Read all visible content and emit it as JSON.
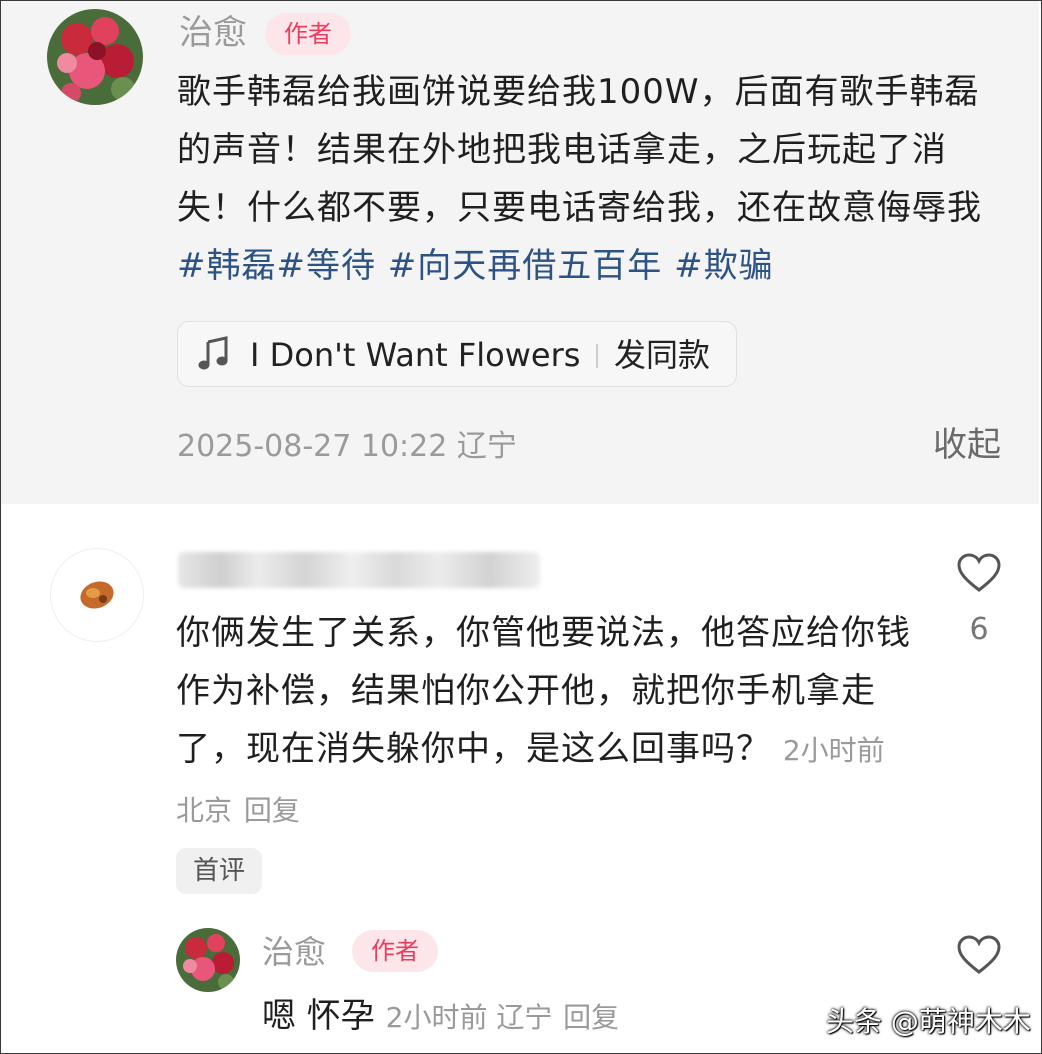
{
  "post": {
    "author": "治愈",
    "badge": "作者",
    "text_plain": "歌手韩磊给我画饼说要给我100W，后面有歌手韩磊的声音！结果在外地把我电话拿走，之后玩起了消失！什么都不要，只要电话寄给我，还在故意侮辱我",
    "tags": [
      "#韩磊",
      "#等待",
      " #向天再借五百年",
      " #欺骗"
    ],
    "music": {
      "icon": "music-note-icon",
      "title": "I Don't Want Flowers",
      "action": "发同款"
    },
    "time_location": "2025-08-27 10:22 辽宁",
    "collapse": "收起"
  },
  "comment": {
    "author_blurred": true,
    "text": "你俩发生了关系，你管他要说法，他答应给你钱作为补偿，结果怕你公开他，就把你手机拿走了，现在消失躲你中，是这么回事吗？",
    "meta": "2小时前 北京",
    "reply": "回复",
    "likes": "6",
    "first_tag": "首评"
  },
  "reply": {
    "author": "治愈",
    "badge": "作者",
    "text": "嗯 怀孕",
    "meta": "2小时前 辽宁",
    "reply": "回复"
  },
  "watermark": "头条 @萌神木木",
  "colors": {
    "badge_bg": "#fde6ea",
    "badge_text": "#ea3c5c",
    "hashtag": "#2c5384",
    "muted": "#9a9a9a"
  }
}
